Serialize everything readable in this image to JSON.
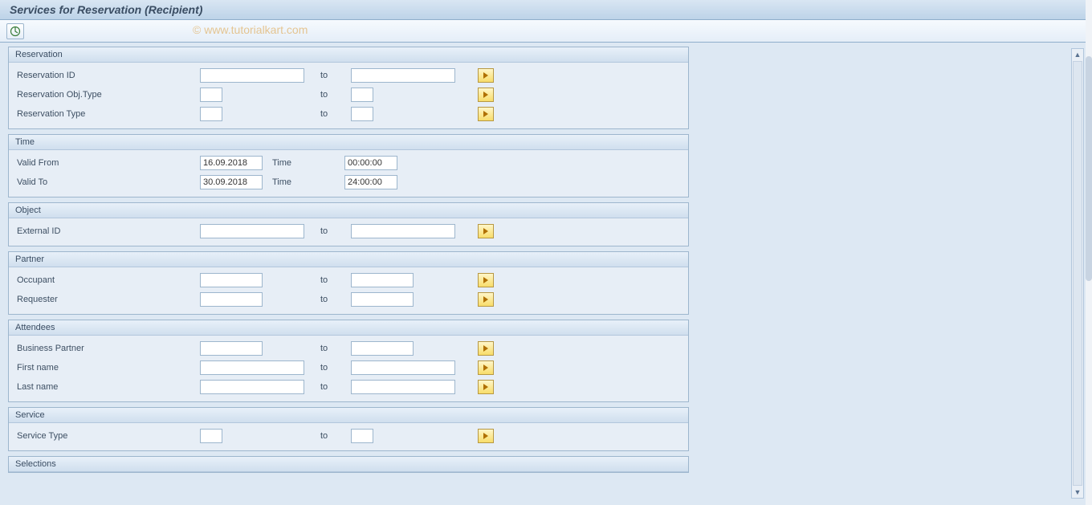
{
  "title": "Services for Reservation (Recipient)",
  "watermark": "© www.tutorialkart.com",
  "labels": {
    "to": "to",
    "time": "Time"
  },
  "groups": {
    "reservation": {
      "title": "Reservation",
      "fields": {
        "res_id": "Reservation ID",
        "res_obj_type": "Reservation Obj.Type",
        "res_type": "Reservation Type"
      },
      "values": {
        "res_id_from": "",
        "res_id_to": "",
        "res_obj_type_from": "",
        "res_obj_type_to": "",
        "res_type_from": "",
        "res_type_to": ""
      }
    },
    "time": {
      "title": "Time",
      "fields": {
        "valid_from": "Valid From",
        "valid_to": "Valid To"
      },
      "values": {
        "valid_from_date": "16.09.2018",
        "valid_from_time": "00:00:00",
        "valid_to_date": "30.09.2018",
        "valid_to_time": "24:00:00"
      }
    },
    "object": {
      "title": "Object",
      "fields": {
        "external_id": "External ID"
      },
      "values": {
        "external_id_from": "",
        "external_id_to": ""
      }
    },
    "partner": {
      "title": "Partner",
      "fields": {
        "occupant": "Occupant",
        "requester": "Requester"
      },
      "values": {
        "occupant_from": "",
        "occupant_to": "",
        "requester_from": "",
        "requester_to": ""
      }
    },
    "attendees": {
      "title": "Attendees",
      "fields": {
        "business_partner": "Business Partner",
        "first_name": "First name",
        "last_name": "Last name"
      },
      "values": {
        "bp_from": "",
        "bp_to": "",
        "fn_from": "",
        "fn_to": "",
        "ln_from": "",
        "ln_to": ""
      }
    },
    "service": {
      "title": "Service",
      "fields": {
        "service_type": "Service Type"
      },
      "values": {
        "service_type_from": "",
        "service_type_to": ""
      }
    },
    "selections": {
      "title": "Selections"
    }
  }
}
